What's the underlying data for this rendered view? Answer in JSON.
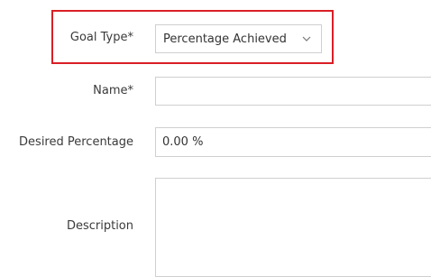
{
  "form": {
    "goal_type": {
      "label": "Goal Type*",
      "value": "Percentage Achieved"
    },
    "name": {
      "label": "Name*",
      "value": ""
    },
    "desired_percentage": {
      "label": "Desired Percentage",
      "value": "0.00 %"
    },
    "description": {
      "label": "Description",
      "value": ""
    }
  },
  "colors": {
    "highlight": "#d81f26",
    "field_border": "#cfcfcf",
    "label_text": "#3a3a3a"
  }
}
